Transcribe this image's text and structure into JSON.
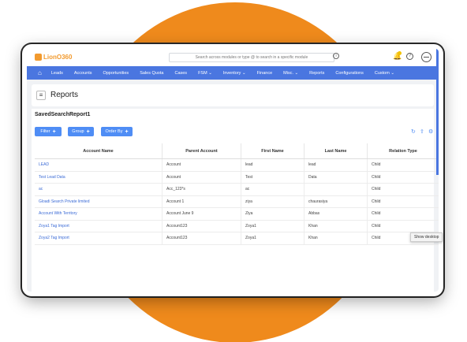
{
  "app": {
    "logo": "LionO360"
  },
  "search": {
    "placeholder": "Search across modules or type @ to search in a specific module"
  },
  "nav": {
    "items": [
      "Leads",
      "Accounts",
      "Opportunities",
      "Sales Quota",
      "Cases",
      "FSM ⌄",
      "Inventory ⌄",
      "Finance",
      "Misc. ⌄",
      "Reports",
      "Configurations",
      "Custom ⌄"
    ]
  },
  "page": {
    "title": "Reports",
    "report_name": "SavedSearchReport1"
  },
  "buttons": {
    "filter": "Filter",
    "group": "Group",
    "order_by": "Order By"
  },
  "table": {
    "headers": [
      "Account Name",
      "Parent Account",
      "First Name",
      "Last Name",
      "Relation Type"
    ],
    "rows": [
      [
        "LEAD",
        "Account",
        "lead",
        "lead",
        "Child"
      ],
      [
        "Test Lead Data",
        "Account",
        "Test",
        "Data",
        "Child"
      ],
      [
        "ac",
        "Acc_123*s",
        "ac",
        "",
        "Child"
      ],
      [
        "Gloadi Search Private limited",
        "Account 1",
        "ziya",
        "chaurasiya",
        "Child"
      ],
      [
        "Account With Territory",
        "Account June 9",
        "Ziya",
        "Abbas",
        "Child"
      ],
      [
        "Zoya1 Tag Import",
        "Account123",
        "Zoya1",
        "Khan",
        "Child"
      ],
      [
        "Zoya2 Tag Import",
        "Account123",
        "Zoya1",
        "Khan",
        "Child"
      ]
    ]
  },
  "tooltip": "Show desktop",
  "colors": {
    "accent": "#4a76e0",
    "button": "#4f8df5",
    "brand": "#f29a2e",
    "backdrop": "#ef8a1c"
  }
}
